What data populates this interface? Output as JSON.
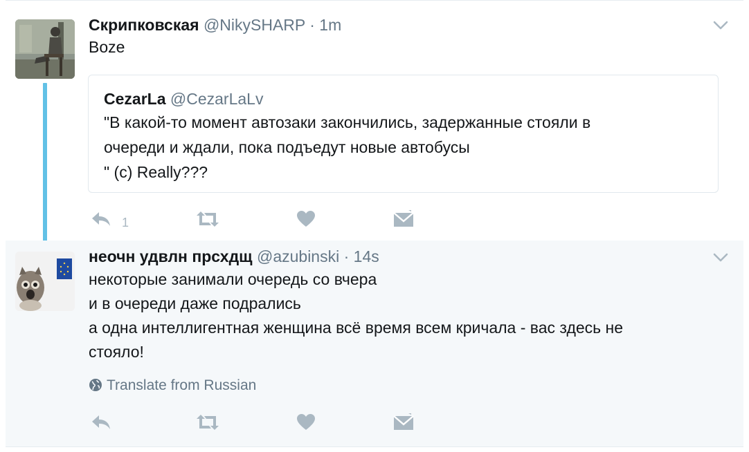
{
  "tweets": [
    {
      "name": "Скрипковская",
      "handle": "@NikySHARP",
      "separator": "·",
      "time": "1m",
      "text": "Boze",
      "quote": {
        "name": "CezarLa",
        "handle": "@CezarLaLv",
        "lines": [
          "\"В какой-то момент автозаки закончились, задержанные стояли в",
          "очереди и ждали, пока подъедут новые автобусы",
          "\" (c) Really???"
        ]
      },
      "reply_count": "1",
      "icons": [
        "reply-icon",
        "retweet-icon",
        "like-icon",
        "message-icon",
        "chevron-down-icon"
      ]
    },
    {
      "name": "неочн удвлн прсхдщ",
      "handle": "@azubinski",
      "separator": "·",
      "time": "14s",
      "lines": [
        "некоторые занимали очередь со вчера",
        "и в очереди даже подрались",
        "а одна интеллигентная женщина всё время всем кричала - вас здесь не",
        "стояло!"
      ],
      "translate_label": "Translate from Russian",
      "icons": [
        "globe-icon",
        "reply-icon",
        "retweet-icon",
        "like-icon",
        "message-icon",
        "chevron-down-icon"
      ]
    }
  ],
  "colors": {
    "thread_line": "#62c1e6",
    "secondary_text": "#657786",
    "action_icon": "#aab8c2",
    "highlight_bg": "#f5f8fa"
  }
}
